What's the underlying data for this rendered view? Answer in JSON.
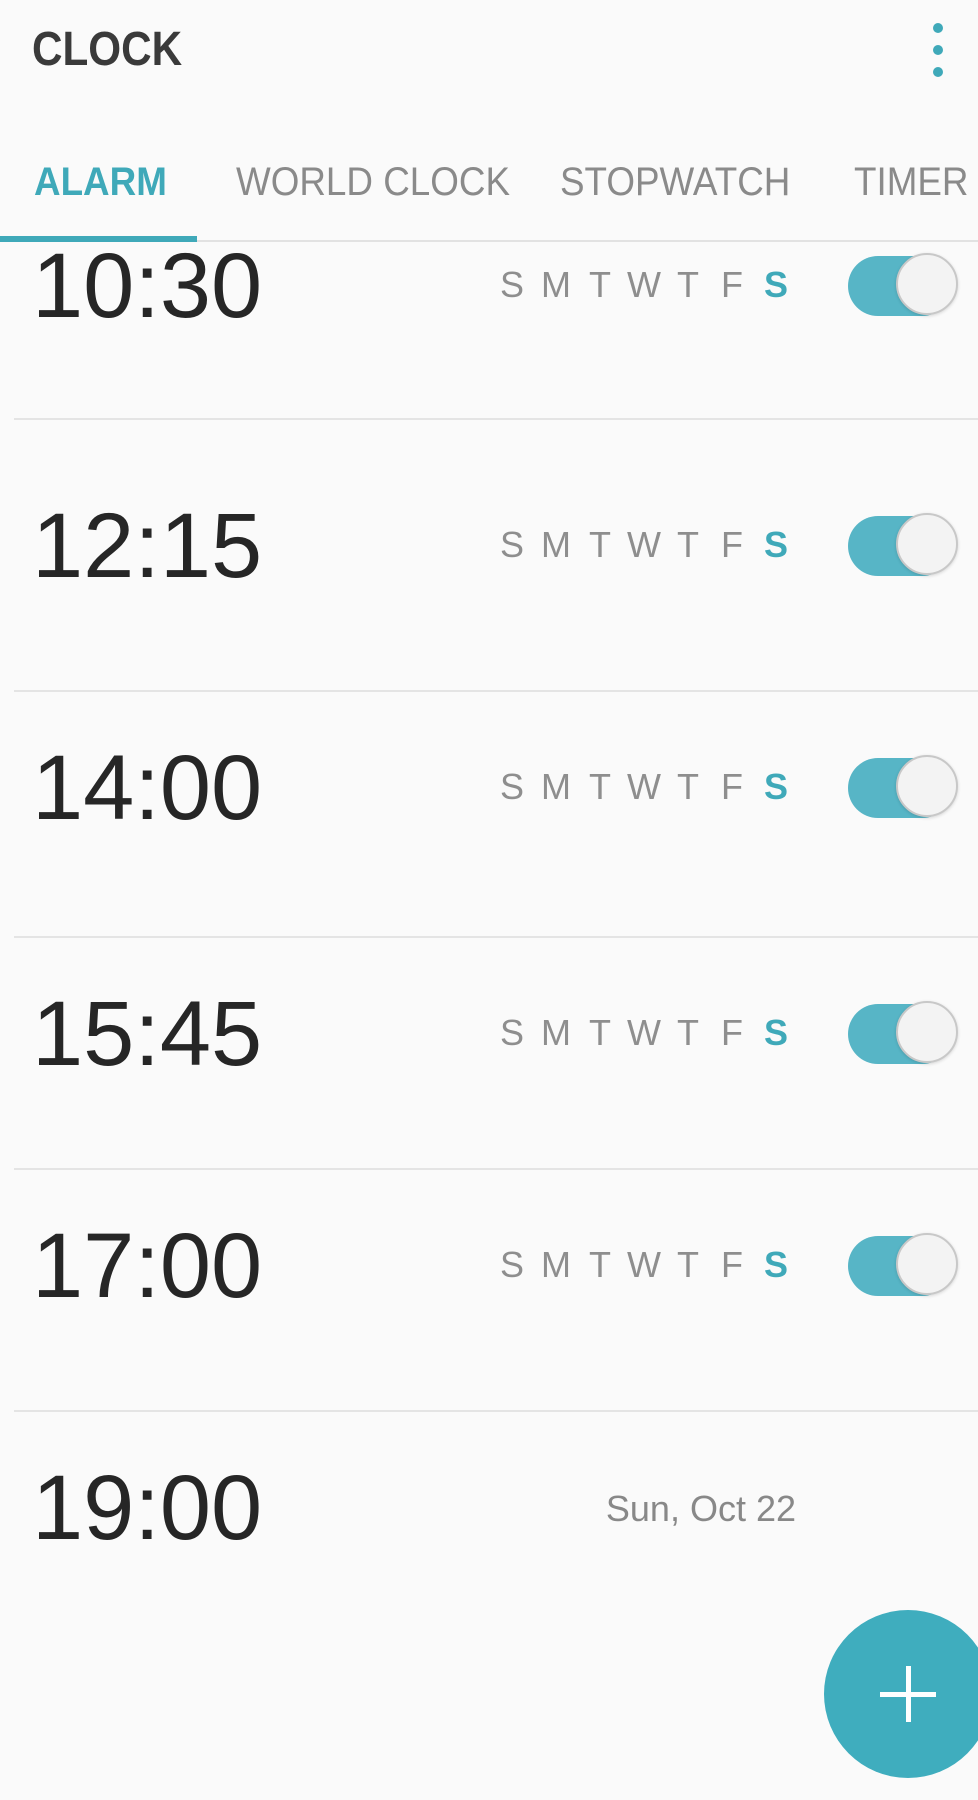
{
  "header": {
    "title": "CLOCK",
    "more_icon": "more-vertical-icon"
  },
  "tabs": [
    {
      "label": "ALARM",
      "active": true
    },
    {
      "label": "WORLD CLOCK",
      "active": false
    },
    {
      "label": "STOPWATCH",
      "active": false
    },
    {
      "label": "TIMER",
      "active": false
    }
  ],
  "colors": {
    "accent": "#3fa9b9",
    "toggle_on": "#57b5c6"
  },
  "alarms": [
    {
      "time": "10:30",
      "days": [
        "S",
        "M",
        "T",
        "W",
        "T",
        "F",
        "S"
      ],
      "active_days": [
        6
      ],
      "enabled": true
    },
    {
      "time": "12:15",
      "days": [
        "S",
        "M",
        "T",
        "W",
        "T",
        "F",
        "S"
      ],
      "active_days": [
        6
      ],
      "enabled": true
    },
    {
      "time": "14:00",
      "days": [
        "S",
        "M",
        "T",
        "W",
        "T",
        "F",
        "S"
      ],
      "active_days": [
        6
      ],
      "enabled": true
    },
    {
      "time": "15:45",
      "days": [
        "S",
        "M",
        "T",
        "W",
        "T",
        "F",
        "S"
      ],
      "active_days": [
        6
      ],
      "enabled": true
    },
    {
      "time": "17:00",
      "days": [
        "S",
        "M",
        "T",
        "W",
        "T",
        "F",
        "S"
      ],
      "active_days": [
        6
      ],
      "enabled": true
    },
    {
      "time": "19:00",
      "date": "Sun, Oct 22"
    }
  ],
  "fab": {
    "icon": "plus-icon"
  }
}
